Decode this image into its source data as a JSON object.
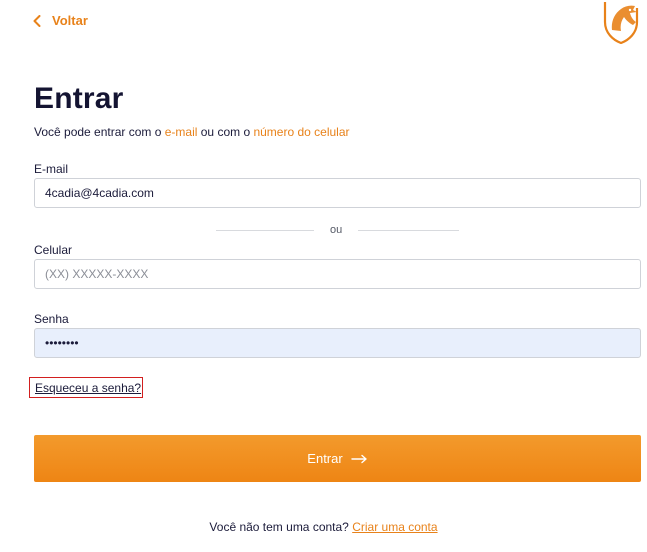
{
  "header": {
    "back_label": "Voltar",
    "logo_icon": "horse-shield-icon"
  },
  "main": {
    "title": "Entrar",
    "subtitle_prefix": "Você pode entrar com o ",
    "subtitle_email_link": "e-mail",
    "subtitle_middle": " ou com o ",
    "subtitle_phone_link": "número do celular"
  },
  "form": {
    "email_label": "E-mail",
    "email_value": "4cadia@4cadia.com",
    "divider_text": "ou",
    "phone_label": "Celular",
    "phone_placeholder": "(XX) XXXXX-XXXX",
    "password_label": "Senha",
    "password_value": "12345678",
    "forgot_label": "Esqueceu a senha?",
    "submit_label": "Entrar",
    "submit_icon": "arrow-right-icon"
  },
  "footer": {
    "signup_prompt": "Você não tem uma conta? ",
    "signup_link": "Criar uma conta"
  },
  "colors": {
    "accent": "#e8821a",
    "heading": "#141432",
    "autofill_bg": "#e8effc",
    "highlight_border": "#d21f1f"
  }
}
